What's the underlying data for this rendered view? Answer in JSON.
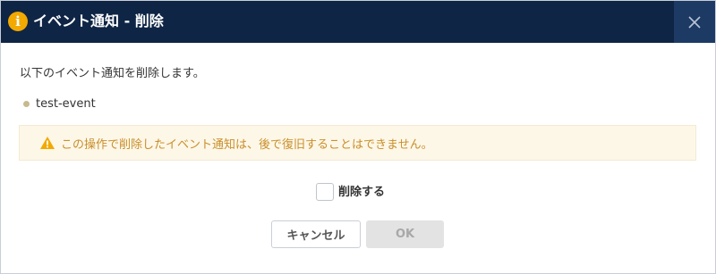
{
  "dialog": {
    "title": "イベント通知 - 削除",
    "title_icon": "info-icon",
    "close_icon": "close-icon"
  },
  "message": "以下のイベント通知を削除します。",
  "event_name": "test-event",
  "warning": {
    "icon": "warning-triangle-icon",
    "text": "この操作で削除したイベント通知は、後で復旧することはできません。"
  },
  "confirm": {
    "label": "削除する",
    "checked": false
  },
  "buttons": {
    "cancel": "キャンセル",
    "ok": "OK",
    "ok_enabled": false
  },
  "colors": {
    "titlebar": "#0f2545",
    "close_bg": "#1c3a64",
    "warning_bg": "#fdf7e8",
    "warning_text": "#c98f2a",
    "warning_icon": "#f2a900"
  }
}
